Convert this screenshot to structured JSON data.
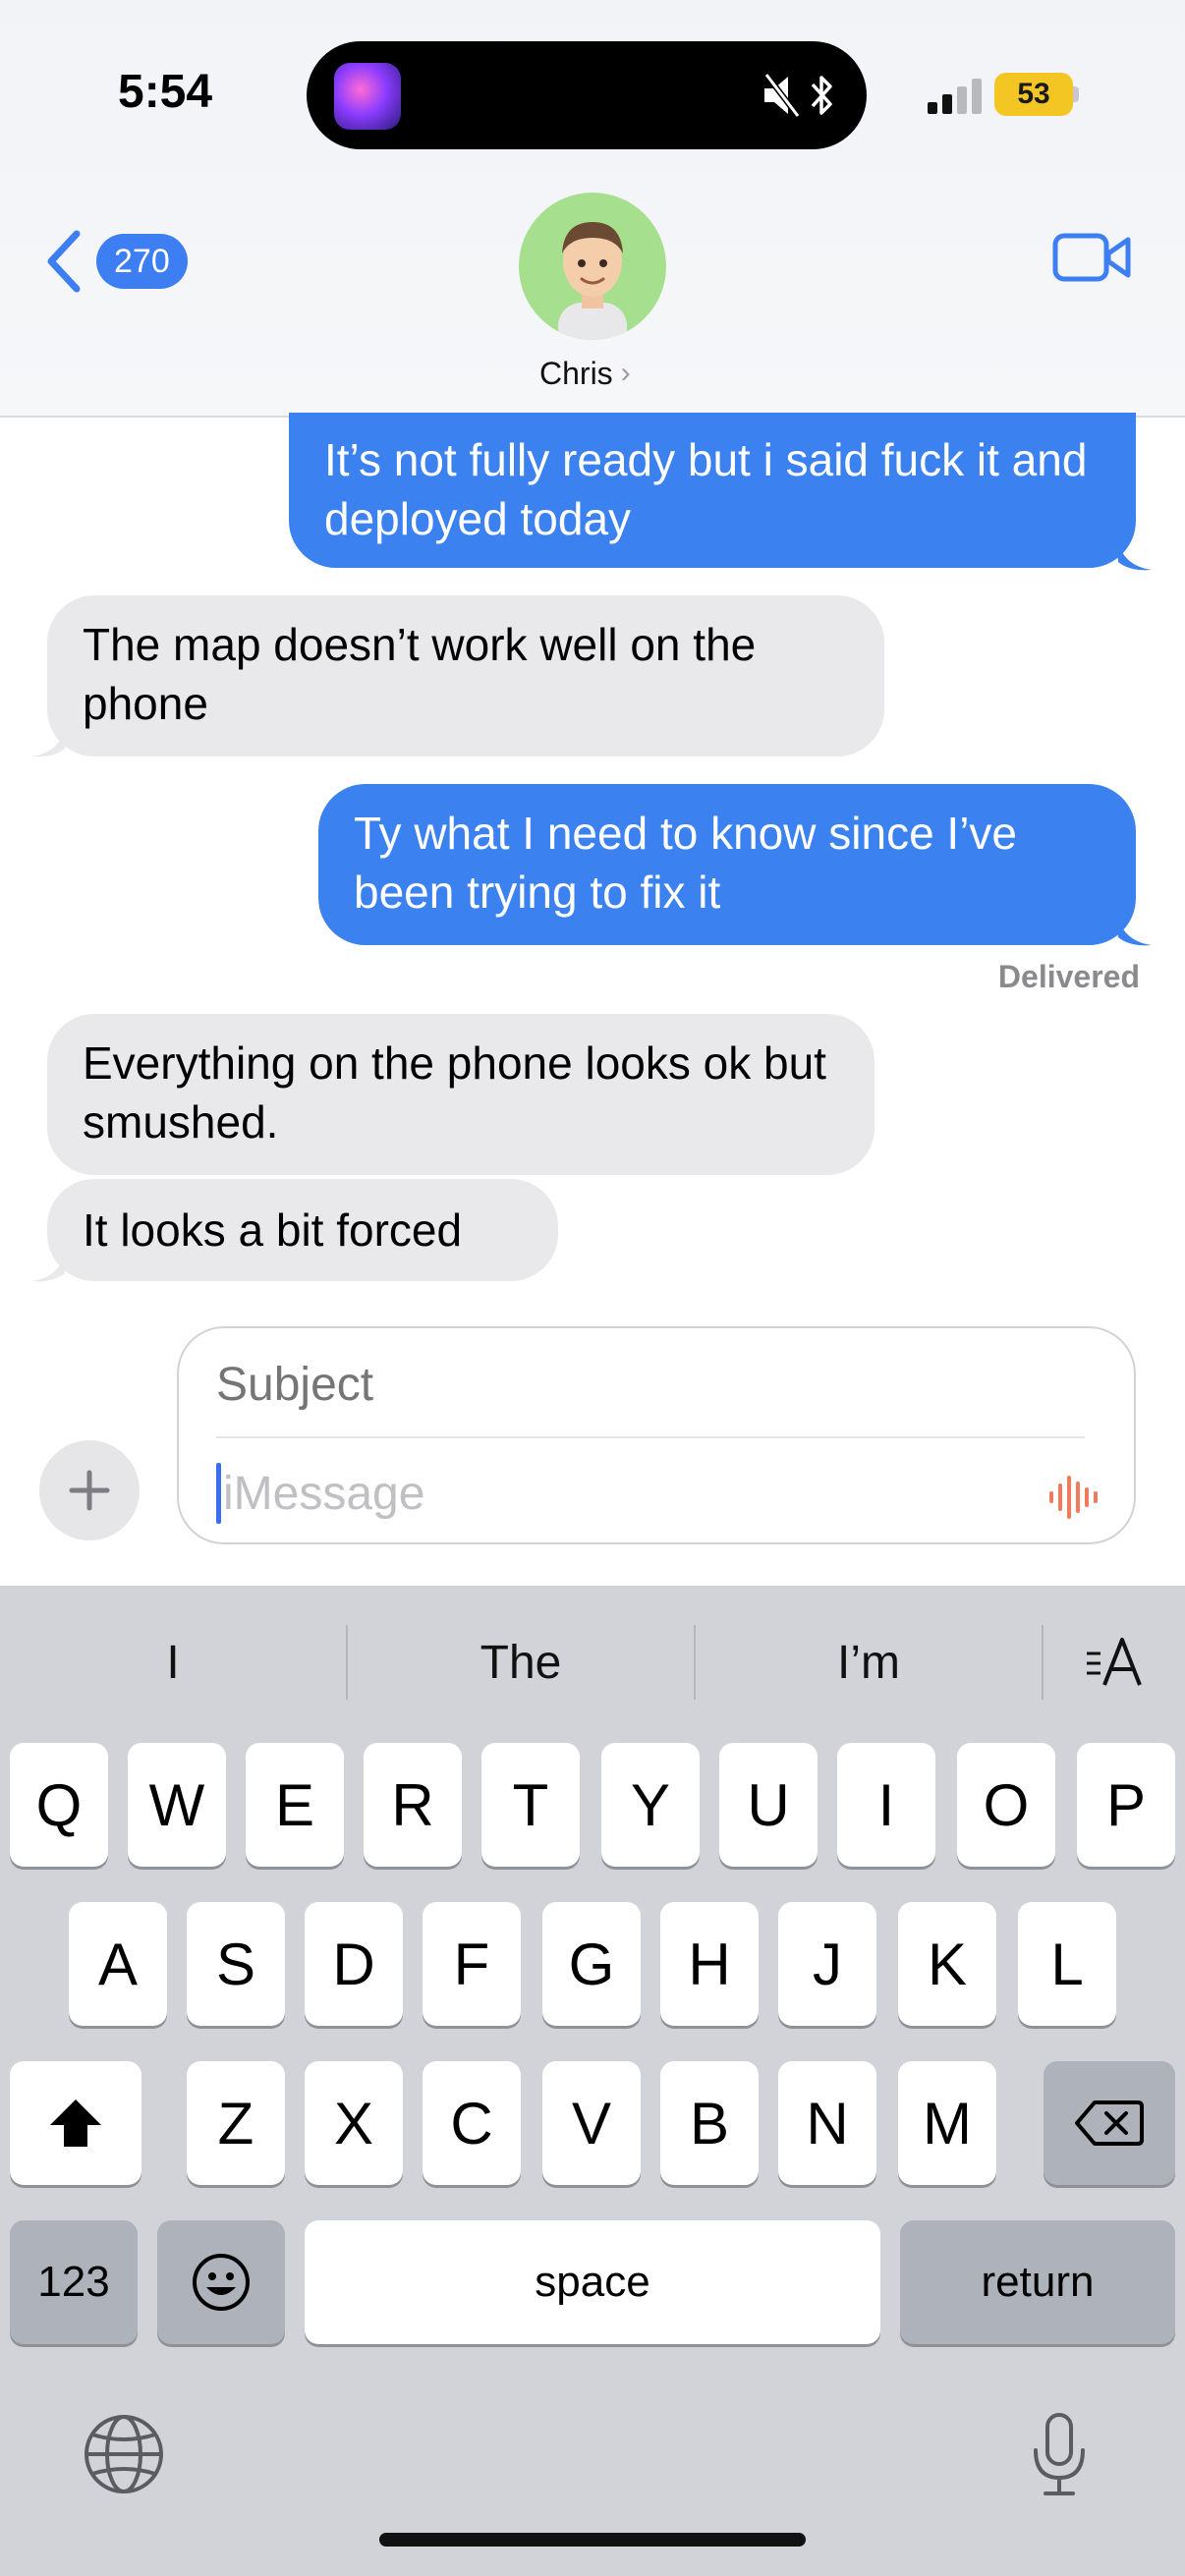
{
  "status_bar": {
    "time": "5:54",
    "battery": "53"
  },
  "header": {
    "back_badge": "270",
    "contact_name": "Chris",
    "chevron": "›"
  },
  "messages": [
    {
      "direction": "outgoing",
      "text": "It’s not fully ready but i said fuck it and deployed today"
    },
    {
      "direction": "incoming",
      "text": "The map doesn’t work well on the phone"
    },
    {
      "direction": "outgoing",
      "text": "Ty what I need to know since I’ve been trying to fix it"
    },
    {
      "direction": "incoming",
      "text": "Everything on the phone looks ok but smushed."
    },
    {
      "direction": "incoming",
      "text": "It looks a bit forced"
    }
  ],
  "delivered_label": "Delivered",
  "compose": {
    "subject_placeholder": "Subject",
    "message_placeholder": "iMessage"
  },
  "keyboard": {
    "suggestions": [
      "I",
      "The",
      "I’m"
    ],
    "row1": [
      "Q",
      "W",
      "E",
      "R",
      "T",
      "Y",
      "U",
      "I",
      "O",
      "P"
    ],
    "row2": [
      "A",
      "S",
      "D",
      "F",
      "G",
      "H",
      "J",
      "K",
      "L"
    ],
    "row3": [
      "Z",
      "X",
      "C",
      "V",
      "B",
      "N",
      "M"
    ],
    "numbers_label": "123",
    "space_label": "space",
    "return_label": "return"
  },
  "colors": {
    "outgoing_bubble": "#3b82f0",
    "incoming_bubble": "#e9e9eb",
    "accent": "#3d7ff2",
    "battery": "#f3c623",
    "audio_icon": "#f07a5a"
  },
  "icons": [
    "back-chevron-icon",
    "video-camera-icon",
    "plus-icon",
    "audio-waveform-icon",
    "shift-icon",
    "delete-icon",
    "emoji-icon",
    "globe-icon",
    "microphone-icon",
    "text-format-icon",
    "mute-icon",
    "bluetooth-icon"
  ]
}
